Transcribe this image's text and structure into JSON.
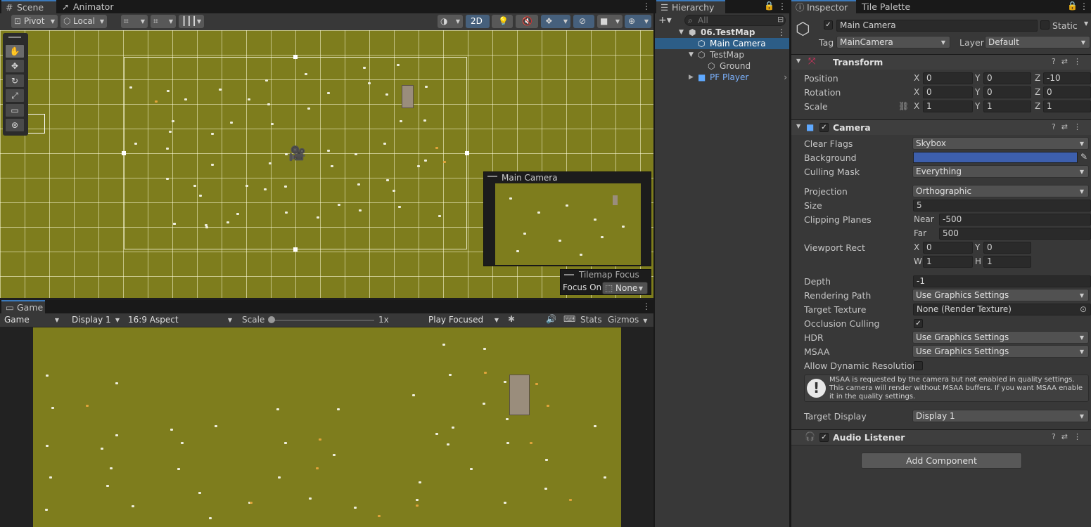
{
  "scene": {
    "tabs": [
      "Scene",
      "Animator"
    ],
    "toolbar": {
      "pivot": "Pivot",
      "local": "Local",
      "mode_2d": "2D"
    },
    "camera_preview_title": "Main Camera",
    "tilemap_focus": {
      "title": "Tilemap Focus",
      "label": "Focus On",
      "value": "None"
    }
  },
  "game": {
    "tab": "Game",
    "toolbar": {
      "view": "Game",
      "display": "Display 1",
      "aspect": "16:9 Aspect",
      "scale_label": "Scale",
      "scale_value": "1x",
      "play_mode": "Play Focused",
      "stats": "Stats",
      "gizmos": "Gizmos"
    }
  },
  "hierarchy": {
    "tab": "Hierarchy",
    "search_placeholder": "All",
    "items": [
      {
        "label": "06.TestMap",
        "indent": 0
      },
      {
        "label": "Main Camera",
        "indent": 2
      },
      {
        "label": "TestMap",
        "indent": 2
      },
      {
        "label": "Ground",
        "indent": 3
      },
      {
        "label": "PF Player",
        "indent": 2
      }
    ]
  },
  "inspector": {
    "tabs": [
      "Inspector",
      "Tile Palette"
    ],
    "object_name": "Main Camera",
    "static_label": "Static",
    "tag_label": "Tag",
    "tag_value": "MainCamera",
    "layer_label": "Layer",
    "layer_value": "Default",
    "transform": {
      "title": "Transform",
      "position_label": "Position",
      "position": [
        "0",
        "0",
        "-10"
      ],
      "rotation_label": "Rotation",
      "rotation": [
        "0",
        "0",
        "0"
      ],
      "scale_label": "Scale",
      "scale": [
        "1",
        "1",
        "1"
      ],
      "axes": [
        "X",
        "Y",
        "Z"
      ]
    },
    "camera": {
      "title": "Camera",
      "clear_flags_label": "Clear Flags",
      "clear_flags": "Skybox",
      "background_label": "Background",
      "background_color": "#3d5fad",
      "culling_mask_label": "Culling Mask",
      "culling_mask": "Everything",
      "projection_label": "Projection",
      "projection": "Orthographic",
      "size_label": "Size",
      "size": "5",
      "clipping_label": "Clipping Planes",
      "near_label": "Near",
      "near": "-500",
      "far_label": "Far",
      "far": "500",
      "viewport_label": "Viewport Rect",
      "vp_x_label": "X",
      "vp_x": "0",
      "vp_y_label": "Y",
      "vp_y": "0",
      "vp_w_label": "W",
      "vp_w": "1",
      "vp_h_label": "H",
      "vp_h": "1",
      "depth_label": "Depth",
      "depth": "-1",
      "rendering_path_label": "Rendering Path",
      "rendering_path": "Use Graphics Settings",
      "target_texture_label": "Target Texture",
      "target_texture": "None (Render Texture)",
      "occlusion_label": "Occlusion Culling",
      "hdr_label": "HDR",
      "hdr": "Use Graphics Settings",
      "msaa_label": "MSAA",
      "msaa": "Use Graphics Settings",
      "dynamic_res_label": "Allow Dynamic Resolution",
      "warning": "MSAA is requested by the camera but not enabled in quality settings. This camera will render without MSAA buffers. If you want MSAA enable it in the quality settings.",
      "target_display_label": "Target Display",
      "target_display": "Display 1"
    },
    "audio_listener": {
      "title": "Audio Listener"
    },
    "add_component": "Add Component"
  },
  "colors": {
    "grass": "#7e7d1d",
    "selection": "#2c5d87",
    "accent_blue": "#3a79bb"
  }
}
